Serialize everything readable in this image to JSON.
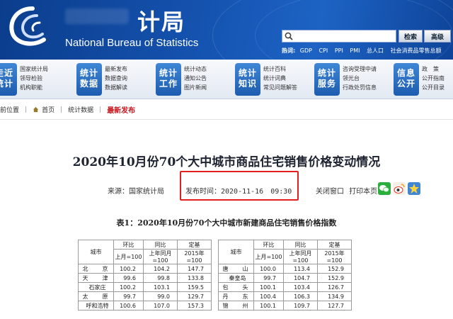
{
  "header": {
    "cn_title": "计局",
    "en_title": "National Bureau of Statistics",
    "search": {
      "placeholder": "",
      "button": "检索",
      "advanced": "高级"
    },
    "hotwords_label": "热词:",
    "hotwords": [
      "GDP",
      "CPI",
      "PPI",
      "PMI",
      "总人口",
      "社会消费品零售总额"
    ]
  },
  "nav": [
    {
      "tile": "走近统计",
      "links": [
        "国家统计局",
        "领导检验",
        "机构职能"
      ]
    },
    {
      "tile": "统计数据",
      "links": [
        "最新发布",
        "数据查询",
        "数据解读"
      ]
    },
    {
      "tile": "统计工作",
      "links": [
        "统计动态",
        "通知公告",
        "图片新闻"
      ]
    },
    {
      "tile": "统计知识",
      "links": [
        "统计百科",
        "统计词典",
        "常见问题解答"
      ]
    },
    {
      "tile": "统计服务",
      "links": [
        "咨询受理中请",
        "领光台",
        "行政处罚信息"
      ]
    },
    {
      "tile": "信息公开",
      "links": [
        "政　策",
        "公开指南",
        "公开目录"
      ]
    }
  ],
  "breadcrumb": {
    "label": "前位置",
    "items": [
      "首页",
      "统计数据"
    ],
    "current": "最新发布"
  },
  "article": {
    "title": "2020年10月份70个大中城市商品住宅销售价格变动情况",
    "source": "来源：国家统计局",
    "time": "发布时间：2020-11-16　09:30",
    "actions": [
      "关闭窗口",
      "打印本页"
    ],
    "table_caption": "表1：2020年10月份70个大中城市新建商品住宅销售价格指数"
  },
  "table": {
    "city_header": "城市",
    "group_headers": [
      "环比",
      "同比",
      "定基"
    ],
    "sub_headers": [
      "上月=100",
      "上年同月=100",
      "2015年=100"
    ],
    "left_rows": [
      {
        "city": "北　京",
        "mom": "100.2",
        "yoy": "104.2",
        "base": "147.7"
      },
      {
        "city": "天　津",
        "mom": "99.6",
        "yoy": "99.8",
        "base": "133.8"
      },
      {
        "city": "石家庄",
        "mom": "100.2",
        "yoy": "103.1",
        "base": "159.5"
      },
      {
        "city": "太　原",
        "mom": "99.7",
        "yoy": "99.0",
        "base": "129.7"
      },
      {
        "city": "呼和浩特",
        "mom": "100.6",
        "yoy": "107.0",
        "base": "157.3"
      }
    ],
    "right_rows": [
      {
        "city": "唐　山",
        "mom": "100.0",
        "yoy": "113.4",
        "base": "152.9"
      },
      {
        "city": "秦皇岛",
        "mom": "99.7",
        "yoy": "104.7",
        "base": "152.9"
      },
      {
        "city": "包　头",
        "mom": "100.1",
        "yoy": "103.4",
        "base": "126.7"
      },
      {
        "city": "丹　东",
        "mom": "100.4",
        "yoy": "106.3",
        "base": "134.9"
      },
      {
        "city": "锦　州",
        "mom": "100.1",
        "yoy": "109.7",
        "base": "127.7"
      }
    ]
  },
  "colors": {
    "header_blue": "#1553b0",
    "accent_red": "#c8141c",
    "highlight_box": "#e02020"
  }
}
